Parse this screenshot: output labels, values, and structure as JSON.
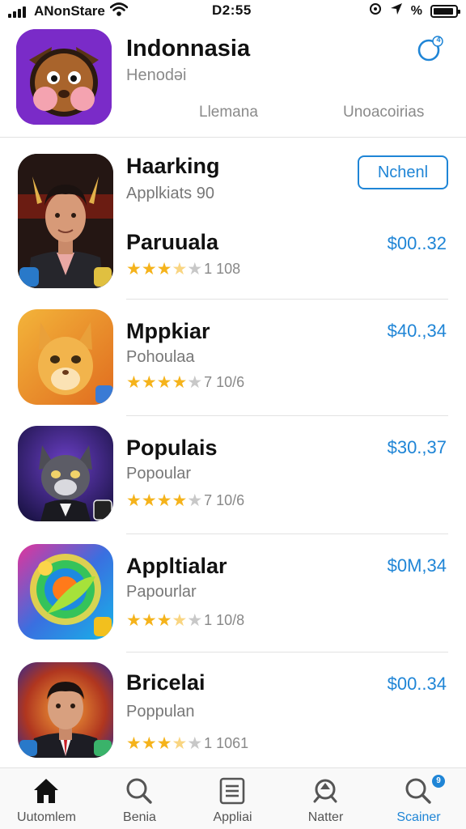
{
  "status_bar": {
    "carrier": "ANonStare",
    "time": "D2:55",
    "battery_percent_label": "%"
  },
  "header": {
    "title": "Indonnasia",
    "subtitle": "Henodəi",
    "tabs": [
      "Llemana",
      "Unoacoirias"
    ],
    "notification_badge": "4"
  },
  "featured": {
    "name": "Haarking",
    "subtitle": "Applkiats 90",
    "button_label": "Nchenl"
  },
  "apps": [
    {
      "name": "Paruuala",
      "subtitle": "",
      "rating": 3.5,
      "rating_count": "1 108",
      "price": "$00..32"
    },
    {
      "name": "Mppkiar",
      "subtitle": "Pohoulaa",
      "rating": 4,
      "rating_count": "7 10/6",
      "price": "$40.,34"
    },
    {
      "name": "Populais",
      "subtitle": "Popoular",
      "rating": 4,
      "rating_count": "7 10/6",
      "price": "$30.,37"
    },
    {
      "name": "Appltialar",
      "subtitle": "Papourlar",
      "rating": 3.5,
      "rating_count": "1 10/8",
      "price": "$0M,34"
    },
    {
      "name": "Bricelai",
      "subtitle": "Poppulan",
      "rating": 3.5,
      "rating_count": "1 1061",
      "price": "$00..34"
    }
  ],
  "tab_bar": {
    "items": [
      {
        "label": "Uutomlem",
        "icon": "home-icon"
      },
      {
        "label": "Benia",
        "icon": "search-icon"
      },
      {
        "label": "Appliai",
        "icon": "apps-list-icon"
      },
      {
        "label": "Natter",
        "icon": "arcade-icon"
      },
      {
        "label": "Scainer",
        "icon": "search-icon",
        "badge": "9"
      }
    ]
  },
  "colors": {
    "accent": "#1f85d6",
    "star": "#f5b31b",
    "divider": "#e2e2e2"
  }
}
